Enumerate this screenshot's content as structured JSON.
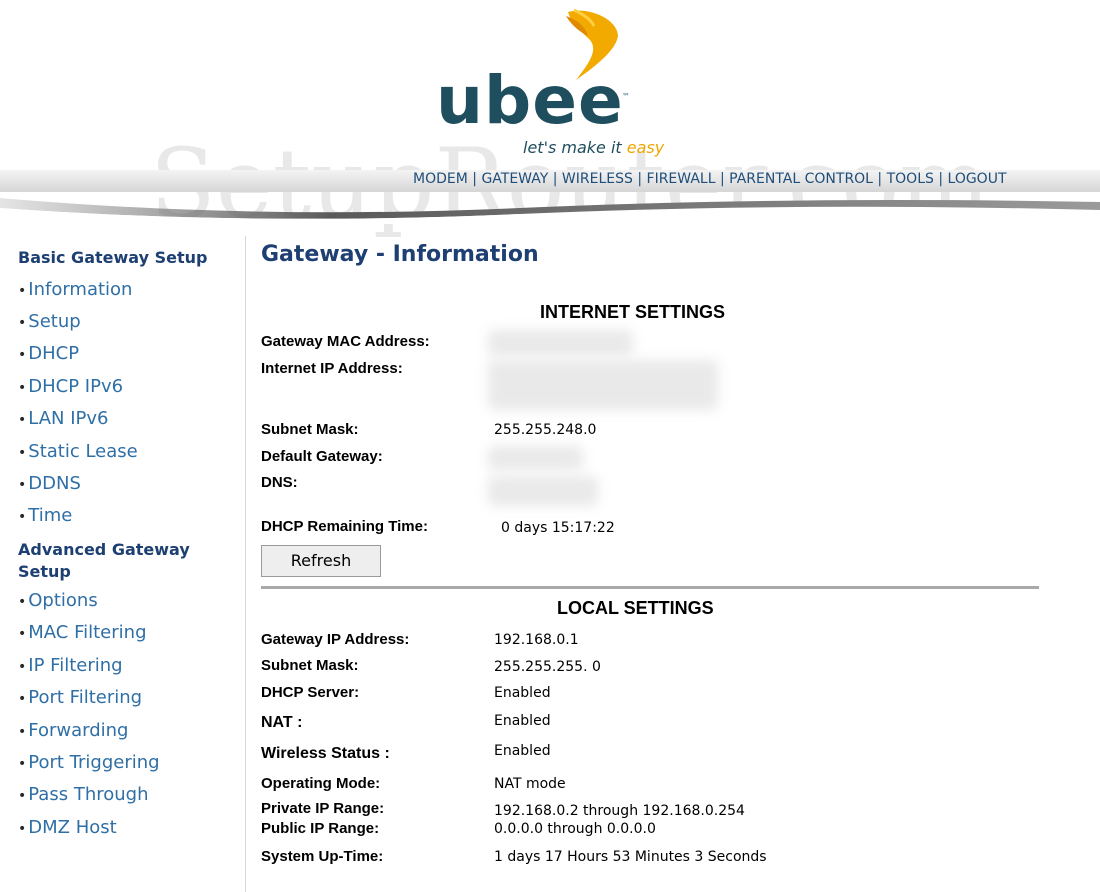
{
  "brand": {
    "logo_text": "ubee",
    "trademark": "™",
    "tagline_main": "let's make it ",
    "tagline_accent": "easy",
    "watermark": "SetupRouter.com"
  },
  "topnav": {
    "items": [
      "MODEM",
      "GATEWAY",
      "WIRELESS",
      "FIREWALL",
      "PARENTAL CONTROL",
      "TOOLS",
      "LOGOUT"
    ],
    "separator": " | "
  },
  "sidebar": {
    "basic_title": "Basic Gateway Setup",
    "basic_items": [
      "Information",
      "Setup",
      "DHCP",
      "DHCP IPv6",
      "LAN IPv6",
      "Static Lease",
      "DDNS",
      "Time"
    ],
    "advanced_title_1": "Advanced Gateway",
    "advanced_title_2": "Setup",
    "advanced_items": [
      "Options",
      "MAC Filtering",
      "IP Filtering",
      "Port Filtering",
      "Forwarding",
      "Port Triggering",
      "Pass Through",
      "DMZ Host"
    ],
    "bullet": "•"
  },
  "main": {
    "title": "Gateway - Information",
    "internet": {
      "heading": "INTERNET SETTINGS",
      "mac_label": "Gateway MAC Address:",
      "ip_label": "Internet IP Address:",
      "subnet_label": "Subnet Mask:",
      "subnet_value": "255.255.248.0",
      "gateway_label": "Default Gateway:",
      "dns_label": "DNS:",
      "dhcp_time_label": "DHCP Remaining Time:",
      "dhcp_time_value": "0 days 15:17:22",
      "refresh_label": "Refresh"
    },
    "local": {
      "heading": "LOCAL SETTINGS",
      "rows": [
        {
          "label": "Gateway IP Address:",
          "value": "192.168.0.1"
        },
        {
          "label": "Subnet Mask:",
          "value": "255.255.255. 0"
        },
        {
          "label": "DHCP Server:",
          "value": "Enabled"
        },
        {
          "label": "NAT :",
          "value": "Enabled"
        },
        {
          "label": "Wireless Status :",
          "value": "Enabled"
        },
        {
          "label": "Operating Mode:",
          "value": "NAT mode"
        },
        {
          "label": "Private IP Range:",
          "value": "192.168.0.2 through 192.168.0.254"
        },
        {
          "label": "Public IP Range:",
          "value": "0.0.0.0 through 0.0.0.0"
        },
        {
          "label": "System Up-Time:",
          "value": "1 days 17 Hours 53 Minutes 3 Seconds"
        }
      ]
    }
  },
  "colors": {
    "brand_teal": "#1f4e5f",
    "accent_orange": "#f0a500",
    "nav_blue": "#1f4e7a",
    "link_blue": "#2f6fa6",
    "heading_navy": "#1d3f72"
  }
}
